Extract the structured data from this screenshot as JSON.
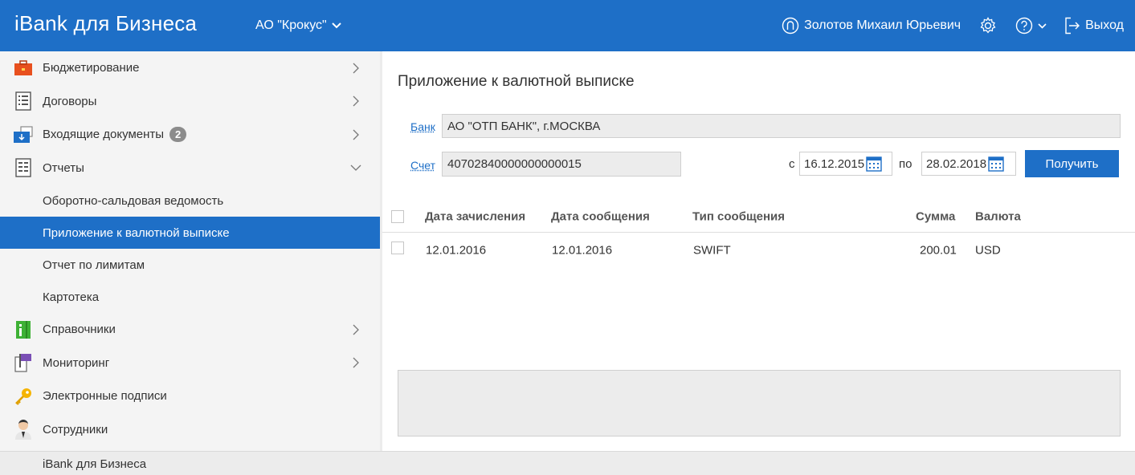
{
  "header": {
    "brand": "iBank для Бизнеса",
    "organization": "АО \"Крокус\"",
    "user_name": "Золотов Михаил Юрьевич",
    "logout_label": "Выход"
  },
  "sidebar": {
    "items": [
      {
        "label": "Бюджетирование",
        "icon": "budget-briefcase-icon"
      },
      {
        "label": "Договоры",
        "icon": "contracts-icon"
      },
      {
        "label": "Входящие документы",
        "icon": "incoming-documents-icon",
        "badge": "2"
      },
      {
        "label": "Отчеты",
        "icon": "reports-icon",
        "expanded": true
      },
      {
        "label": "Справочники",
        "icon": "directories-icon"
      },
      {
        "label": "Мониторинг",
        "icon": "monitoring-flag-icon"
      },
      {
        "label": "Электронные подписи",
        "icon": "key-icon"
      },
      {
        "label": "Сотрудники",
        "icon": "employee-icon"
      }
    ],
    "report_subitems": [
      "Оборотно-сальдовая ведомость",
      "Приложение к валютной выписке",
      "Отчет по лимитам",
      "Картотека"
    ],
    "active_subitem": "Приложение к валютной выписке"
  },
  "main": {
    "title": "Приложение к валютной выписке",
    "bank_label": "Банк",
    "bank_value": "АО \"ОТП БАНК\", г.МОСКВА",
    "account_label": "Счет",
    "account_value": "40702840000000000015",
    "date_from_label": "с",
    "date_from": "16.12.2015",
    "date_to_label": "по",
    "date_to": "28.02.2018",
    "submit_label": "Получить"
  },
  "table": {
    "headers": [
      "Дата зачисления",
      "Дата сообщения",
      "Тип сообщения",
      "Сумма",
      "Валюта"
    ],
    "rows": [
      [
        "12.01.2016",
        "12.01.2016",
        "SWIFT",
        "200.01",
        "USD"
      ]
    ]
  },
  "footer": {
    "brand": "iBank для Бизнеса"
  },
  "colors": {
    "accent": "#1e6fc7",
    "sidebar_bg": "#f4f4f4",
    "field_bg": "#ececec"
  }
}
